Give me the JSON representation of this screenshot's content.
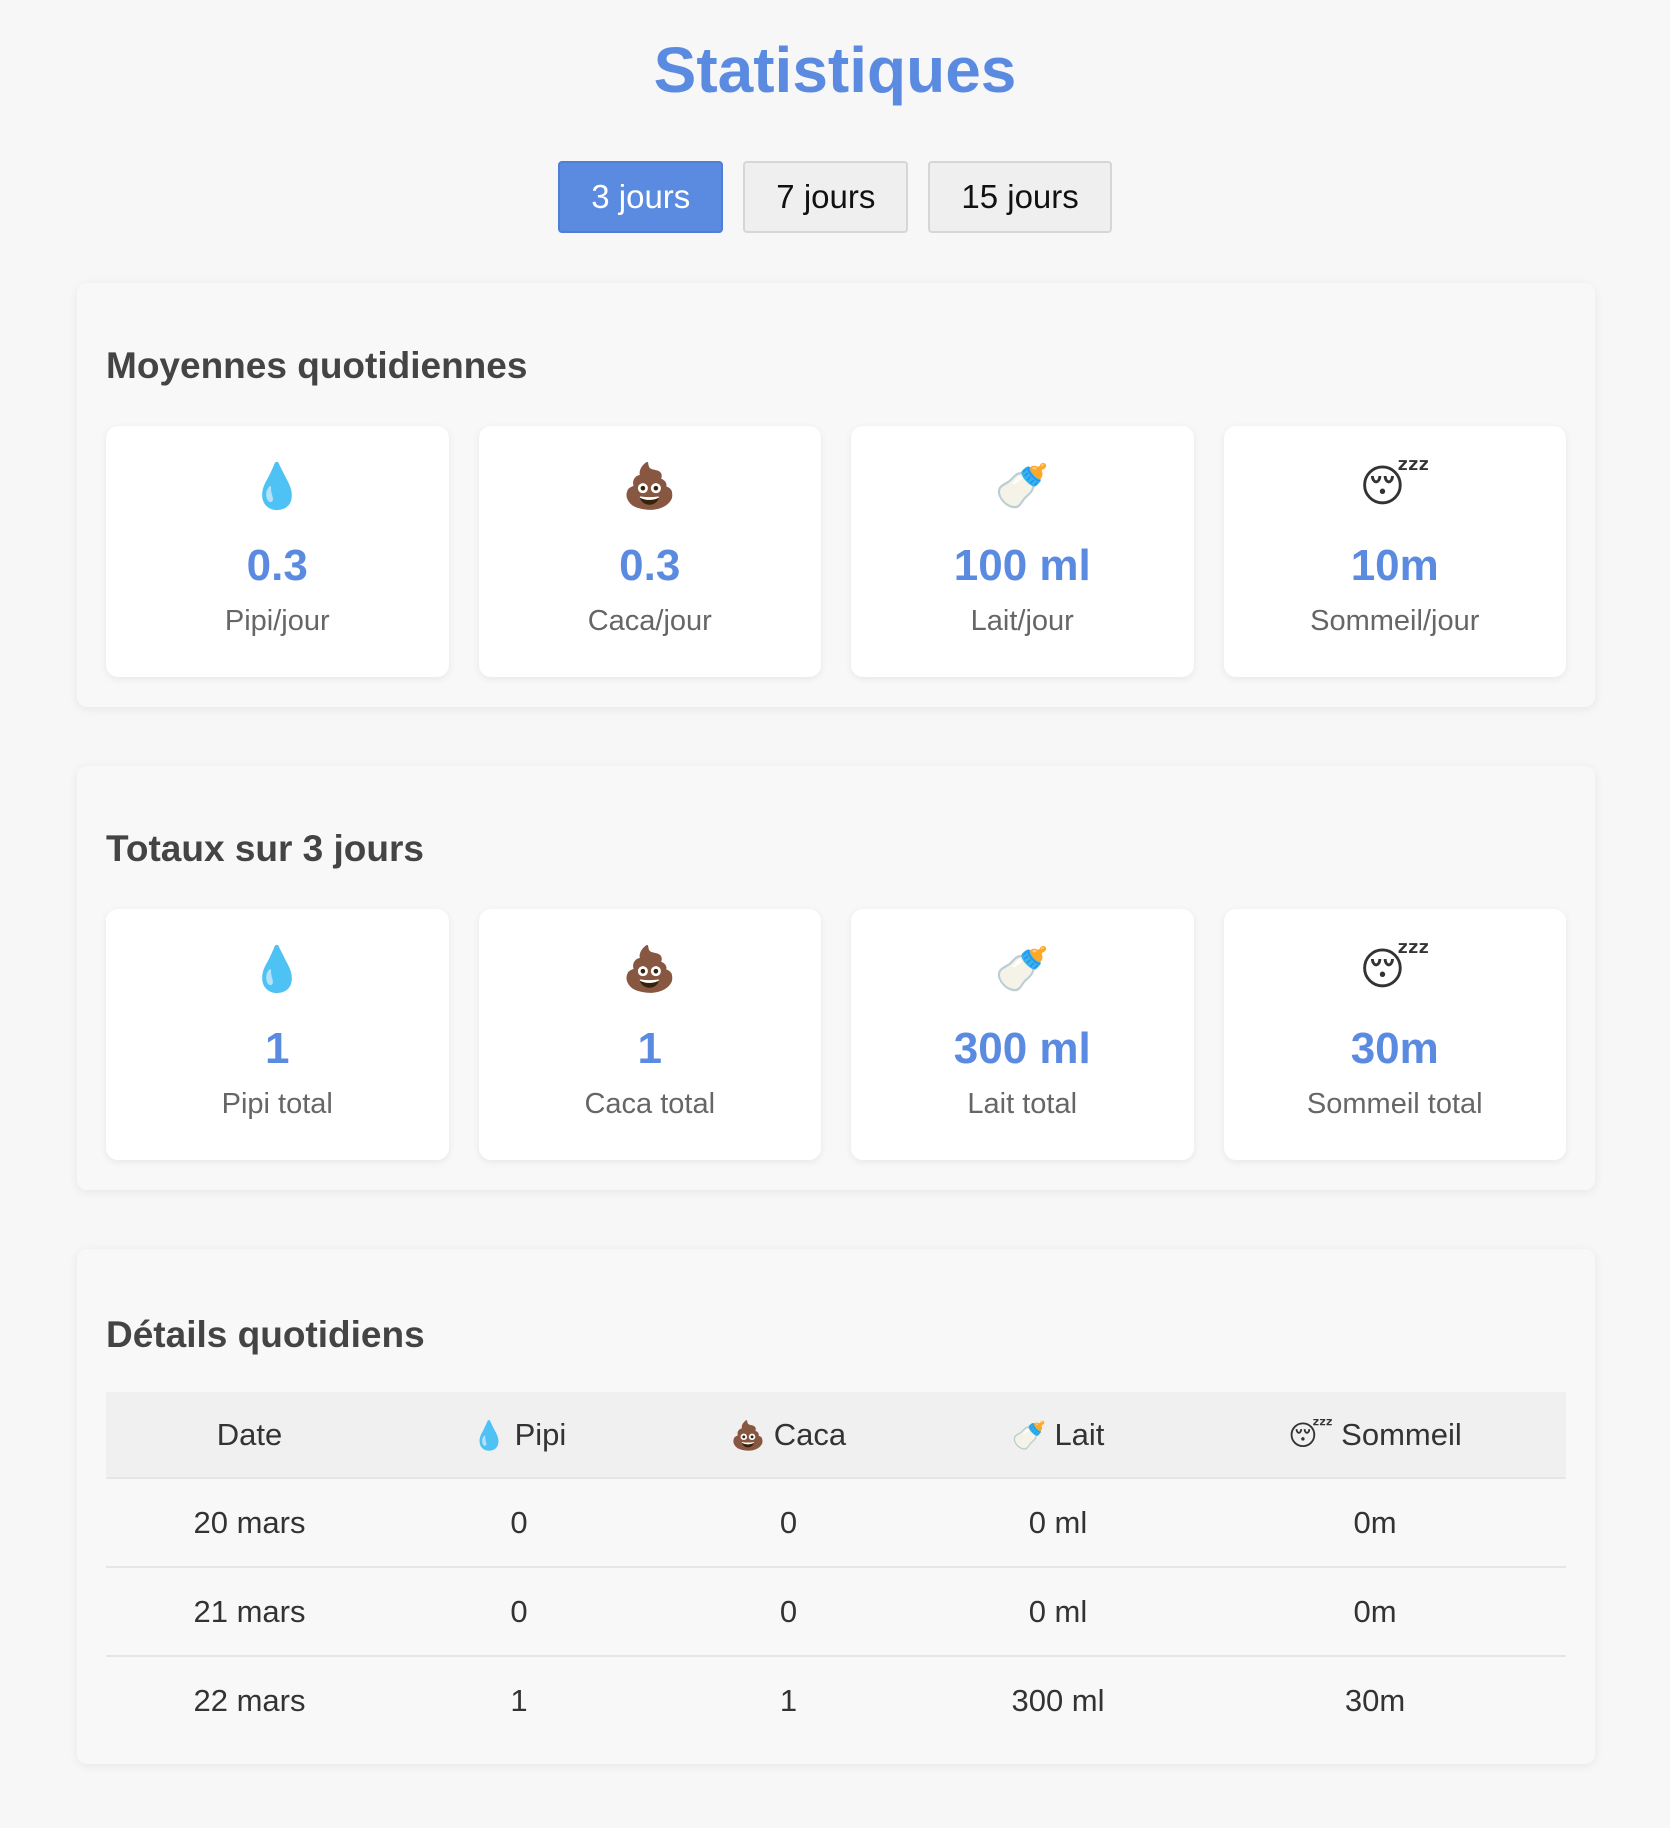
{
  "page": {
    "title": "Statistiques"
  },
  "periods": [
    {
      "label": "3 jours",
      "active": true
    },
    {
      "label": "7 jours",
      "active": false
    },
    {
      "label": "15 jours",
      "active": false
    }
  ],
  "averages": {
    "title": "Moyennes quotidiennes",
    "cards": [
      {
        "icon": "💧",
        "icon_name": "droplet-icon",
        "value": "0.3",
        "label": "Pipi/jour"
      },
      {
        "icon": "💩",
        "icon_name": "poop-icon",
        "value": "0.3",
        "label": "Caca/jour"
      },
      {
        "icon": "🍼",
        "icon_name": "baby-bottle-icon",
        "value": "100 ml",
        "label": "Lait/jour"
      },
      {
        "icon": "😴",
        "icon_name": "sleeping-face-icon",
        "value": "10m",
        "label": "Sommeil/jour"
      }
    ]
  },
  "totals": {
    "title": "Totaux sur 3 jours",
    "cards": [
      {
        "icon": "💧",
        "icon_name": "droplet-icon",
        "value": "1",
        "label": "Pipi total"
      },
      {
        "icon": "💩",
        "icon_name": "poop-icon",
        "value": "1",
        "label": "Caca total"
      },
      {
        "icon": "🍼",
        "icon_name": "baby-bottle-icon",
        "value": "300 ml",
        "label": "Lait total"
      },
      {
        "icon": "😴",
        "icon_name": "sleeping-face-icon",
        "value": "30m",
        "label": "Sommeil total"
      }
    ]
  },
  "details": {
    "title": "Détails quotidiens",
    "headers": [
      {
        "icon": "",
        "label": "Date"
      },
      {
        "icon": "💧",
        "label": "Pipi"
      },
      {
        "icon": "💩",
        "label": "Caca"
      },
      {
        "icon": "🍼",
        "label": "Lait"
      },
      {
        "icon": "😴",
        "label": "Sommeil"
      }
    ],
    "rows": [
      [
        "20 mars",
        "0",
        "0",
        "0 ml",
        "0m"
      ],
      [
        "21 mars",
        "0",
        "0",
        "0 ml",
        "0m"
      ],
      [
        "22 mars",
        "1",
        "1",
        "300 ml",
        "30m"
      ]
    ]
  },
  "colors": {
    "accent": "#5b8be0",
    "background": "#f7f7f7",
    "card": "#ffffff"
  }
}
